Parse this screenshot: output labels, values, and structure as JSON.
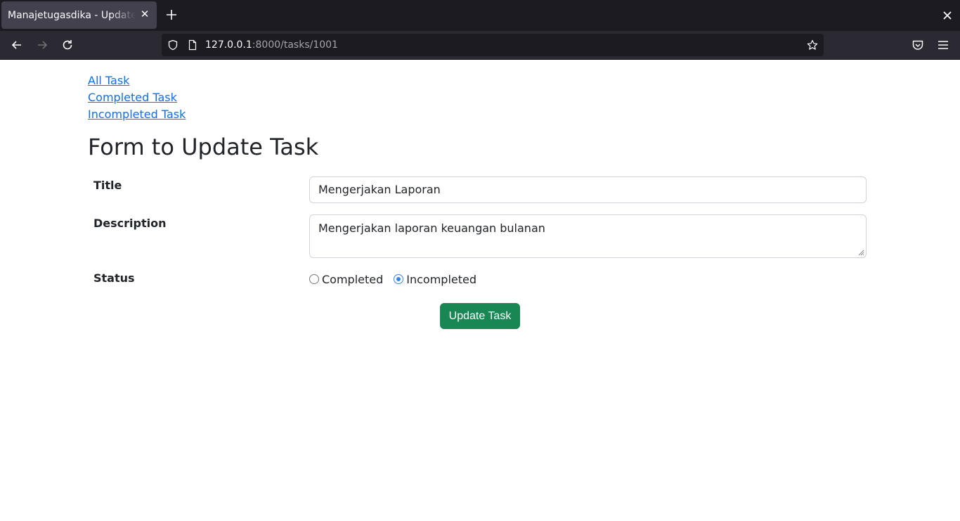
{
  "browser": {
    "tab_title": "Manajetugasdika - Update Task",
    "url_host": "127.0.0.1",
    "url_path": ":8000/tasks/1001"
  },
  "nav": {
    "links": [
      {
        "label": "All Task"
      },
      {
        "label": "Completed Task"
      },
      {
        "label": "Incompleted Task"
      }
    ]
  },
  "form": {
    "heading": "Form to Update Task",
    "title_label": "Title",
    "title_value": "Mengerjakan Laporan",
    "description_label": "Description",
    "description_value": "Mengerjakan laporan keuangan bulanan",
    "status_label": "Status",
    "status_options": [
      {
        "label": "Completed",
        "selected": false
      },
      {
        "label": "Incompleted",
        "selected": true
      }
    ],
    "submit_label": "Update Task"
  },
  "colors": {
    "link": "#0d6efd",
    "submit_button": "#198754",
    "radio_accent": "#3584e4"
  }
}
